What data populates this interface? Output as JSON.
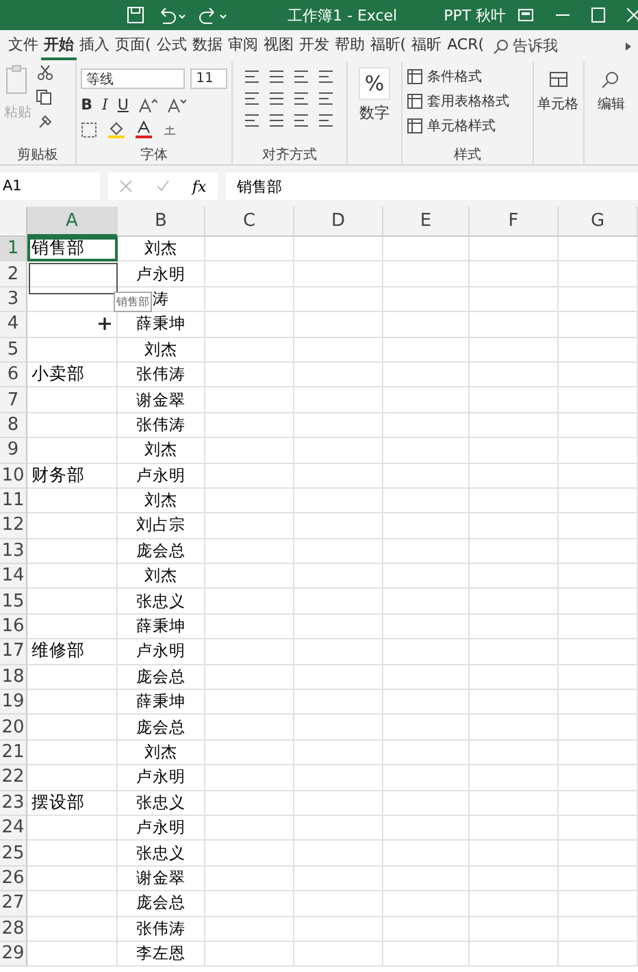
{
  "window": {
    "title": "工作簿1 - Excel",
    "user": "PPT 秋叶"
  },
  "tabs": [
    {
      "label": "文件",
      "selected": false
    },
    {
      "label": "开始",
      "selected": true
    },
    {
      "label": "插入",
      "selected": false
    },
    {
      "label": "页面(",
      "selected": false
    },
    {
      "label": "公式",
      "selected": false
    },
    {
      "label": "数据",
      "selected": false
    },
    {
      "label": "审阅",
      "selected": false
    },
    {
      "label": "视图",
      "selected": false
    },
    {
      "label": "开发",
      "selected": false
    },
    {
      "label": "帮助",
      "selected": false
    },
    {
      "label": "福昕(",
      "selected": false
    },
    {
      "label": "福昕",
      "selected": false
    },
    {
      "label": "ACR(",
      "selected": false
    }
  ],
  "tell_me": "告诉我",
  "ribbon": {
    "clipboard": {
      "paste": "粘贴",
      "label": "剪贴板"
    },
    "font": {
      "name": "等线",
      "size": "11",
      "bold": "B",
      "italic": "I",
      "underline": "U",
      "label": "字体"
    },
    "alignment": {
      "label": "对齐方式"
    },
    "number": {
      "symbol": "%",
      "label": "数字"
    },
    "styles": {
      "items": [
        "条件格式",
        "套用表格格式",
        "单元格样式"
      ],
      "label": "样式"
    },
    "cells": {
      "label": "单元格"
    },
    "editing": {
      "label": "编辑"
    }
  },
  "formula_bar": {
    "name_box": "A1",
    "function_label": "fx",
    "value": "销售部"
  },
  "columns": [
    {
      "label": "A",
      "selected": true
    },
    {
      "label": "B",
      "selected": false
    },
    {
      "label": "C",
      "selected": false
    },
    {
      "label": "D",
      "selected": false
    },
    {
      "label": "E",
      "selected": false
    },
    {
      "label": "F",
      "selected": false
    },
    {
      "label": "G",
      "selected": false
    }
  ],
  "rows": [
    {
      "header": "1",
      "a": "销售部",
      "b": "刘杰",
      "selected": true
    },
    {
      "header": "2",
      "a": "",
      "b": "卢永明",
      "selected": false
    },
    {
      "header": "3",
      "a": "",
      "b": "涛",
      "selected": false
    },
    {
      "header": "4",
      "a": "",
      "b": "薛秉坤",
      "selected": false
    },
    {
      "header": "5",
      "a": "",
      "b": "刘杰",
      "selected": false
    },
    {
      "header": "6",
      "a": "小卖部",
      "b": "张伟涛",
      "selected": false
    },
    {
      "header": "7",
      "a": "",
      "b": "谢金翠",
      "selected": false
    },
    {
      "header": "8",
      "a": "",
      "b": "张伟涛",
      "selected": false
    },
    {
      "header": "9",
      "a": "",
      "b": "刘杰",
      "selected": false
    },
    {
      "header": "10",
      "a": "财务部",
      "b": "卢永明",
      "selected": false
    },
    {
      "header": "11",
      "a": "",
      "b": "刘杰",
      "selected": false
    },
    {
      "header": "12",
      "a": "",
      "b": "刘占宗",
      "selected": false
    },
    {
      "header": "13",
      "a": "",
      "b": "庞会总",
      "selected": false
    },
    {
      "header": "14",
      "a": "",
      "b": "刘杰",
      "selected": false
    },
    {
      "header": "15",
      "a": "",
      "b": "张忠义",
      "selected": false
    },
    {
      "header": "16",
      "a": "",
      "b": "薛秉坤",
      "selected": false
    },
    {
      "header": "17",
      "a": "维修部",
      "b": "卢永明",
      "selected": false
    },
    {
      "header": "18",
      "a": "",
      "b": "庞会总",
      "selected": false
    },
    {
      "header": "19",
      "a": "",
      "b": "薛秉坤",
      "selected": false
    },
    {
      "header": "20",
      "a": "",
      "b": "庞会总",
      "selected": false
    },
    {
      "header": "21",
      "a": "",
      "b": "刘杰",
      "selected": false
    },
    {
      "header": "22",
      "a": "",
      "b": "卢永明",
      "selected": false
    },
    {
      "header": "23",
      "a": "摆设部",
      "b": "张忠义",
      "selected": false
    },
    {
      "header": "24",
      "a": "",
      "b": "卢永明",
      "selected": false
    },
    {
      "header": "25",
      "a": "",
      "b": "张忠义",
      "selected": false
    },
    {
      "header": "26",
      "a": "",
      "b": "谢金翠",
      "selected": false
    },
    {
      "header": "27",
      "a": "",
      "b": "庞会总",
      "selected": false
    },
    {
      "header": "28",
      "a": "",
      "b": "张伟涛",
      "selected": false
    },
    {
      "header": "29",
      "a": "",
      "b": "李左恩",
      "selected": false
    }
  ],
  "drag_tooltip": "销售部"
}
